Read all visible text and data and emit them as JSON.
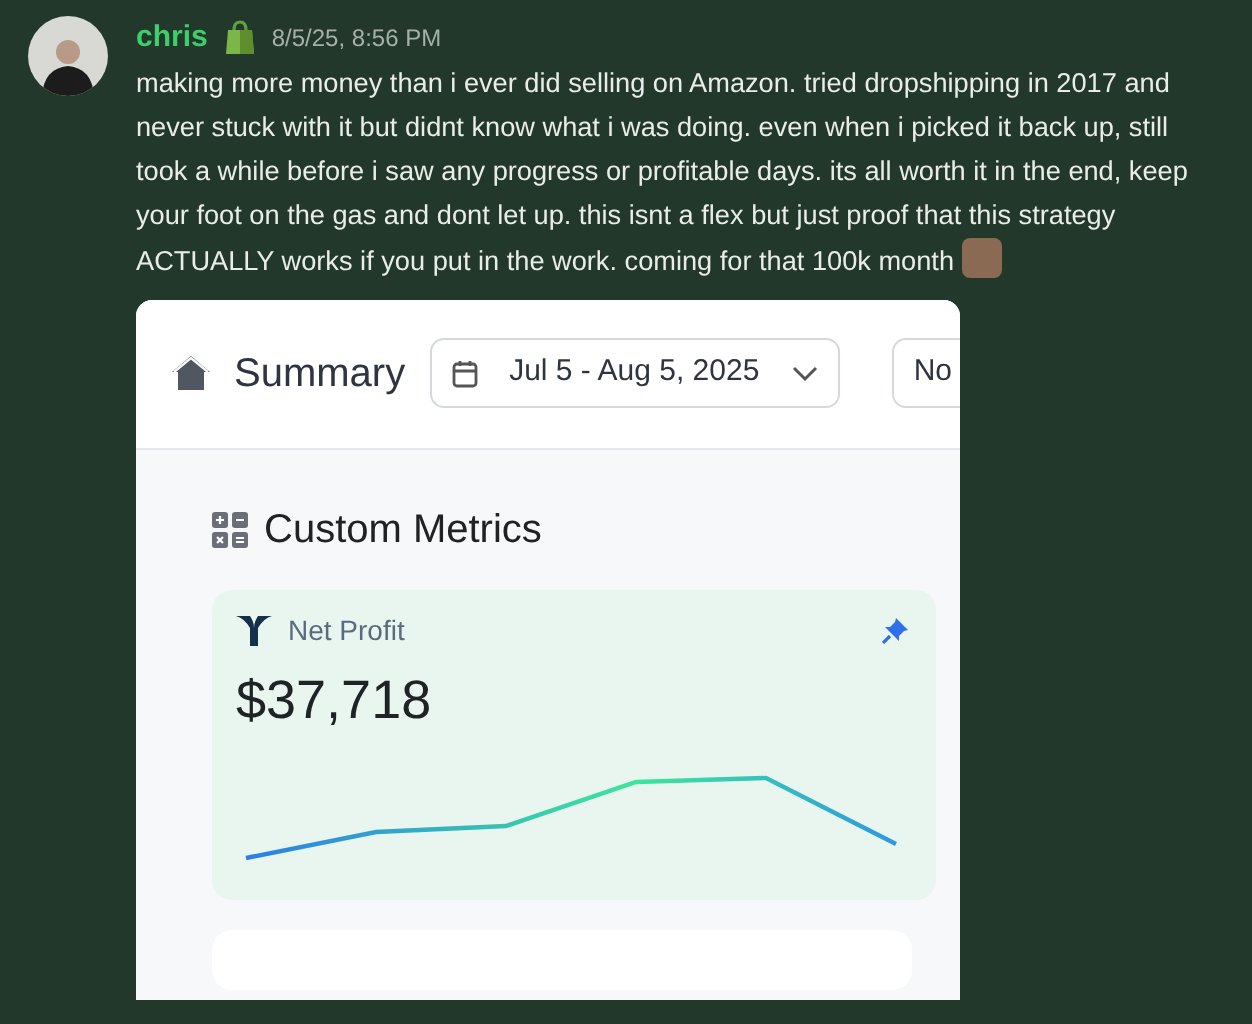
{
  "message": {
    "author": "chris",
    "timestamp": "8/5/25, 8:56 PM",
    "text": "making more money than i ever did selling on Amazon. tried dropshipping in 2017 and never stuck with it but didnt know what i was doing. even when i picked it back up, still took a while before i saw any progress or profitable days. its all worth it in the end, keep your foot on the gas and dont let up. this isnt a flex but just proof that this strategy ACTUALLY works if you put in the work. coming for that 100k month",
    "attachment": {
      "title": "Summary",
      "date_range": "Jul 5 - Aug 5, 2025",
      "button_2": "No",
      "section_title": "Custom Metrics",
      "metric": {
        "label": "Net Profit",
        "value": "$37,718"
      }
    }
  }
}
